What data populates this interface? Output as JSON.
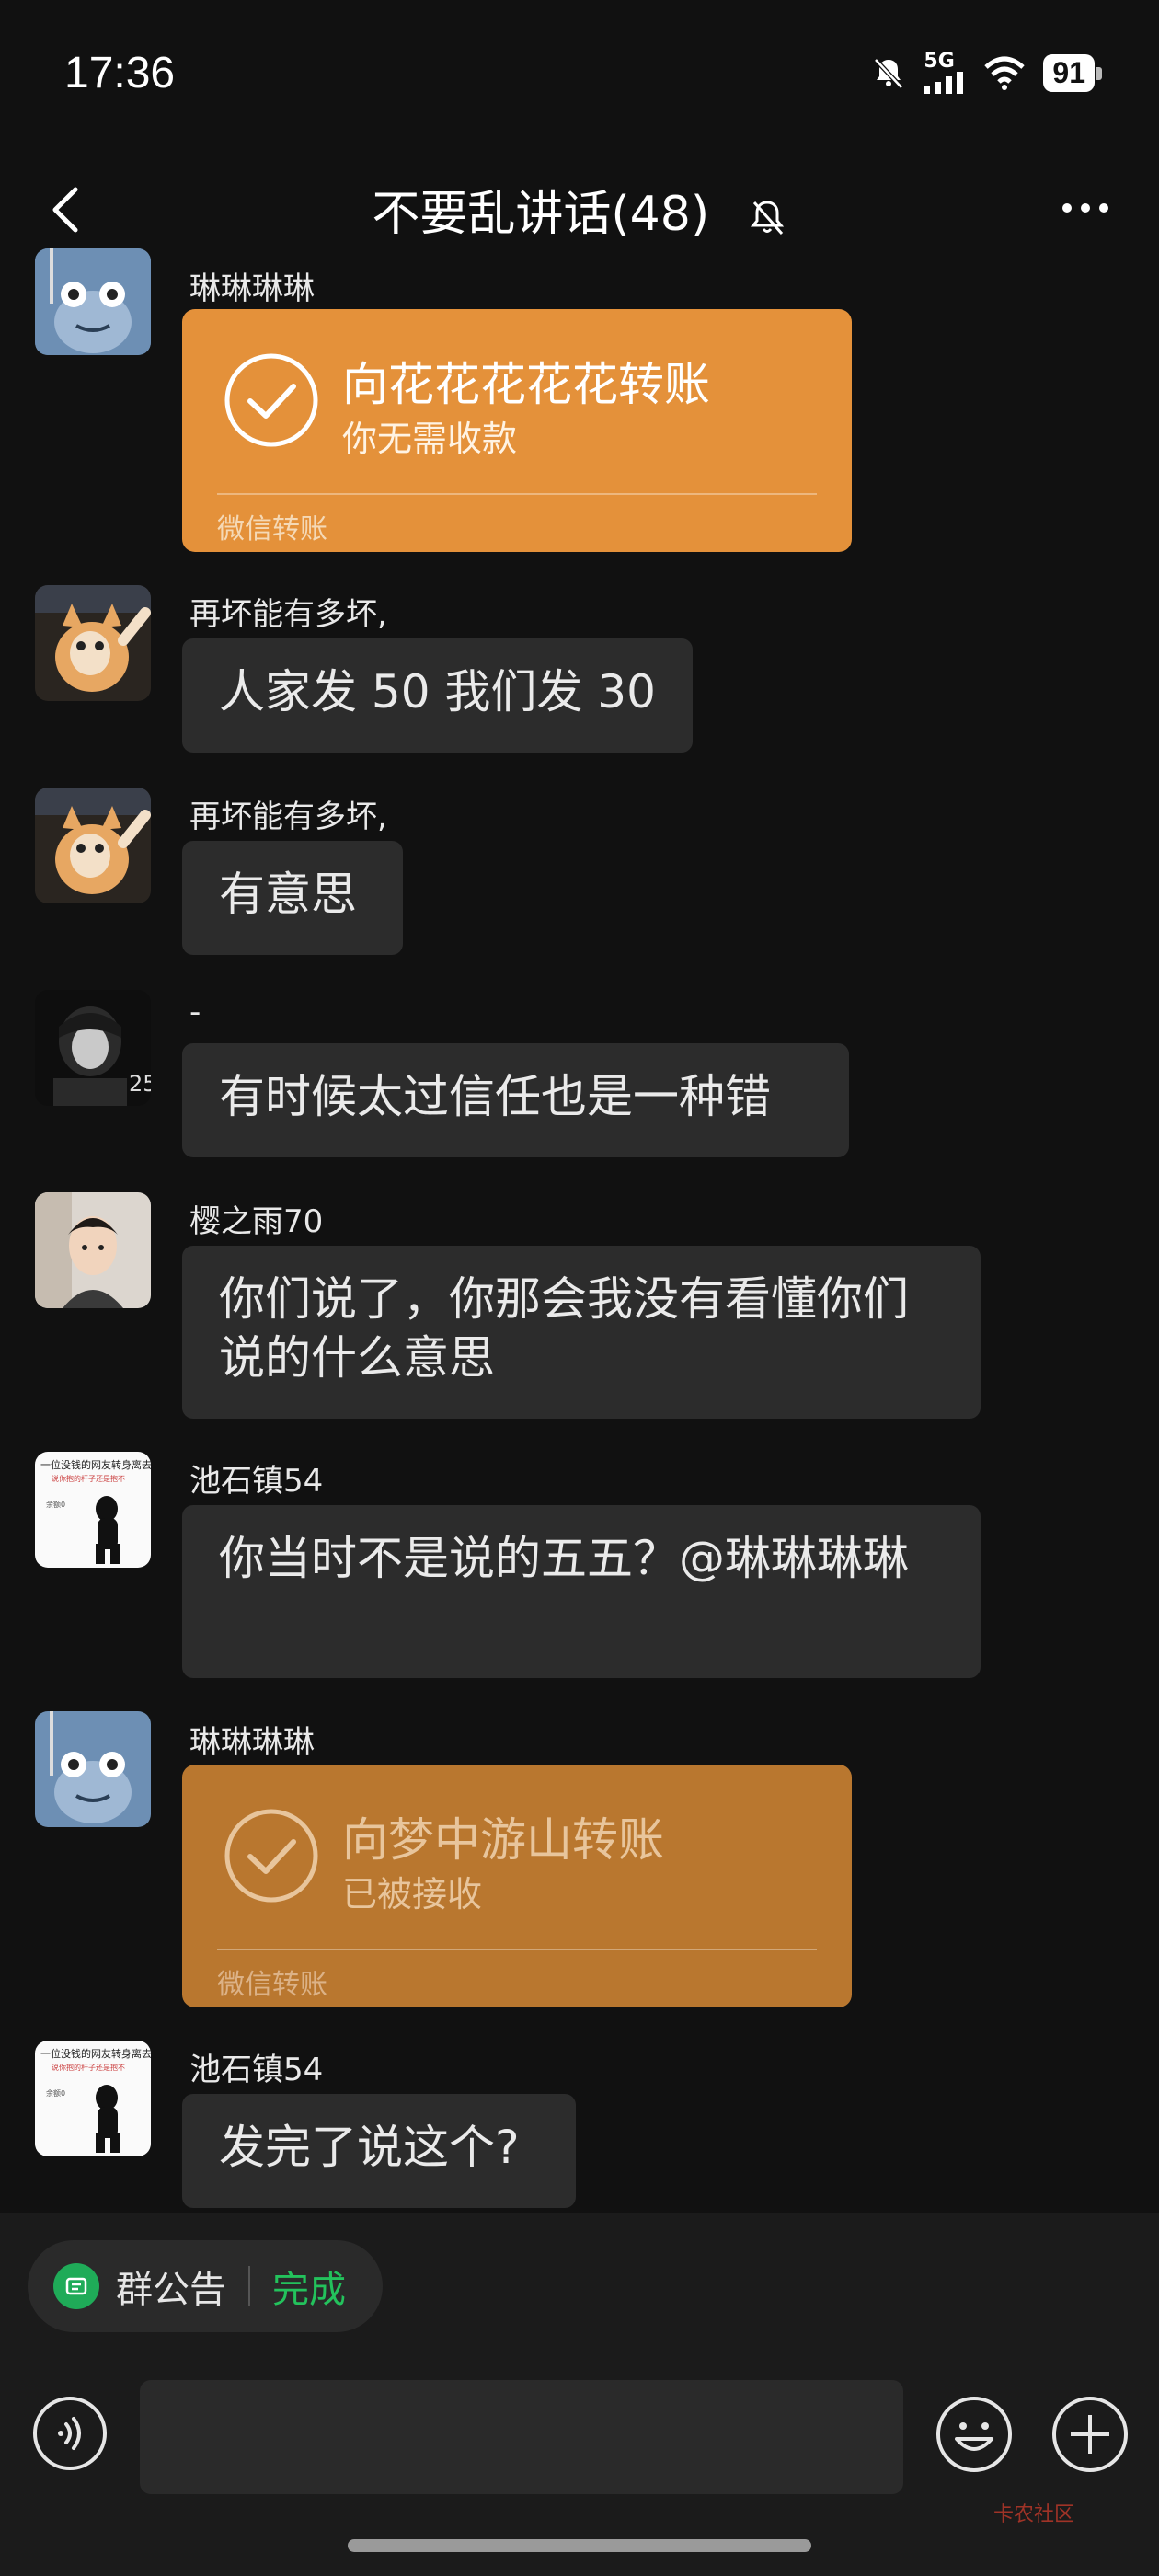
{
  "status_bar": {
    "time": "17:36",
    "network": "5G",
    "battery": "91"
  },
  "header": {
    "title": "不要乱讲话(48)"
  },
  "messages": [
    {
      "sender": "琳琳琳琳",
      "type": "transfer",
      "transfer_title": "向花花花花花转账",
      "transfer_status": "你无需收款",
      "transfer_footer": "微信转账"
    },
    {
      "sender": "再坏能有多坏,",
      "type": "text",
      "text": "人家发 50 我们发 30"
    },
    {
      "sender": "再坏能有多坏,",
      "type": "text",
      "text": "有意思"
    },
    {
      "sender": "-",
      "type": "text",
      "text": "有时候太过信任也是一种错"
    },
    {
      "sender": "樱之雨70",
      "type": "text",
      "text": "你们说了，你那会我没有看懂你们说的什么意思"
    },
    {
      "sender": "池石镇54",
      "type": "text",
      "text": "你当时不是说的五五？@琳琳琳琳"
    },
    {
      "sender": "琳琳琳琳",
      "type": "transfer",
      "transfer_title": "向梦中游山转账",
      "transfer_status": "已被接收",
      "transfer_footer": "微信转账"
    },
    {
      "sender": "池石镇54",
      "type": "text",
      "text": "发完了说这个?"
    }
  ],
  "footer": {
    "notice_label": "群公告",
    "notice_action": "完成",
    "watermark": "卡农社区"
  },
  "colors": {
    "transfer_active": "#e4913a",
    "transfer_received": "#b9772f",
    "accent_green": "#23c25c"
  }
}
